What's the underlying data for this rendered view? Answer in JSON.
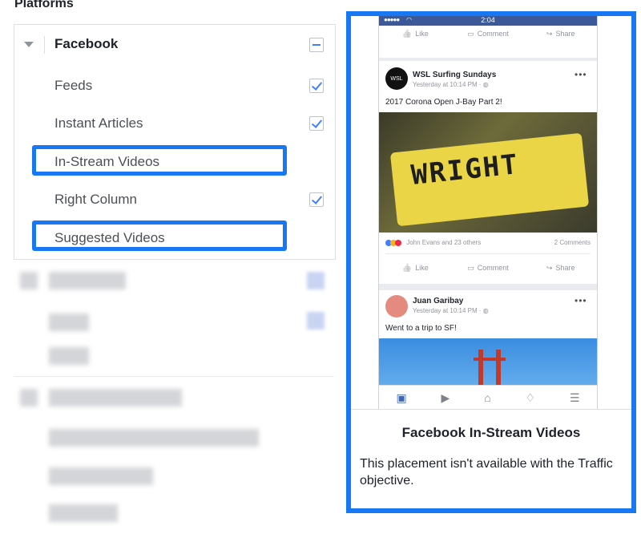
{
  "section_heading": "Platforms",
  "placements": {
    "parent": {
      "label": "Facebook",
      "checkbox": "indeterminate"
    },
    "items": [
      {
        "label": "Feeds",
        "checked": true
      },
      {
        "label": "Instant Articles",
        "checked": true
      },
      {
        "label": "In-Stream Videos",
        "checked": false,
        "highlighted": true
      },
      {
        "label": "Right Column",
        "checked": true
      },
      {
        "label": "Suggested Videos",
        "checked": false,
        "highlighted": true
      }
    ]
  },
  "preview": {
    "phone": {
      "status_time": "2:04",
      "status_signal": "●●●●● ",
      "top_actions": {
        "like": "Like",
        "comment": "Comment",
        "share": "Share"
      },
      "post1": {
        "page_name": "WSL Surfing Sundays",
        "avatar_text": "WSL",
        "meta": "Yesterday at 10:14 PM · ",
        "text": "2017 Corona Open J-Bay Part 2!",
        "video_text": "WRIGHT",
        "reactions": "John Evans and 23 others",
        "comments": "2 Comments",
        "actions": {
          "like": "Like",
          "comment": "Comment",
          "share": "Share"
        }
      },
      "post2": {
        "page_name": "Juan Garibay",
        "meta": "Yesterday at 10:14 PM · ",
        "text": "Went to a trip to SF!"
      },
      "tab_icons": [
        "news-feed-icon",
        "video-icon",
        "marketplace-icon",
        "notifications-icon",
        "menu-icon"
      ]
    },
    "title": "Facebook In-Stream Videos",
    "description": "This placement isn't available with the Traffic objective."
  },
  "colors": {
    "highlight": "#1877f2",
    "checkbox": "#4080ff",
    "fb_blue": "#3b5998"
  }
}
